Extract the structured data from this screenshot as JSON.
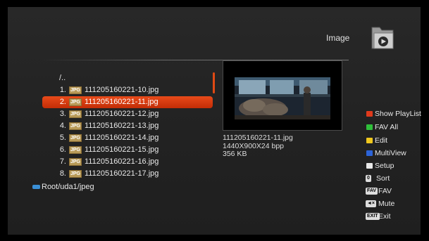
{
  "header": {
    "title": "Image"
  },
  "list": {
    "parent": "/..",
    "items": [
      {
        "num": "1.",
        "badge": "JPG",
        "name": "111205160221-10.jpg"
      },
      {
        "num": "2.",
        "badge": "JPG",
        "name": "111205160221-11.jpg"
      },
      {
        "num": "3.",
        "badge": "JPG",
        "name": "111205160221-12.jpg"
      },
      {
        "num": "4.",
        "badge": "JPG",
        "name": "111205160221-13.jpg"
      },
      {
        "num": "5.",
        "badge": "JPG",
        "name": "111205160221-14.jpg"
      },
      {
        "num": "6.",
        "badge": "JPG",
        "name": "111205160221-15.jpg"
      },
      {
        "num": "7.",
        "badge": "JPG",
        "name": "111205160221-16.jpg"
      },
      {
        "num": "8.",
        "badge": "JPG",
        "name": "111205160221-17.jpg"
      }
    ],
    "selected_index": 1
  },
  "path": "Root/uda1/jpeg",
  "preview": {
    "filename": "111205160221-11.jpg",
    "dimensions": "1440X900X24 bpp",
    "size": "356 KB"
  },
  "legend": [
    {
      "label": "Show PlayList",
      "icon": "red-button",
      "color": "#e03a1c"
    },
    {
      "label": "FAV All",
      "icon": "green-button",
      "color": "#2fbf3a"
    },
    {
      "label": "Edit",
      "icon": "yellow-button",
      "color": "#f0c81e"
    },
    {
      "label": "MultiView",
      "icon": "blue-button",
      "color": "#2c63d8"
    },
    {
      "label": "Setup",
      "icon": "white-button",
      "color": "#e8e8e8"
    },
    {
      "label": "Sort",
      "icon": "zero-key",
      "key": "0"
    },
    {
      "label": "FAV",
      "icon": "fav-key",
      "key": "FAV"
    },
    {
      "label": "Mute",
      "icon": "mute-key",
      "key": "◄×"
    },
    {
      "label": "Exit",
      "icon": "exit-key",
      "key": "EXIT"
    }
  ],
  "colors": {
    "accent": "#d9380f",
    "background": "#242424"
  }
}
